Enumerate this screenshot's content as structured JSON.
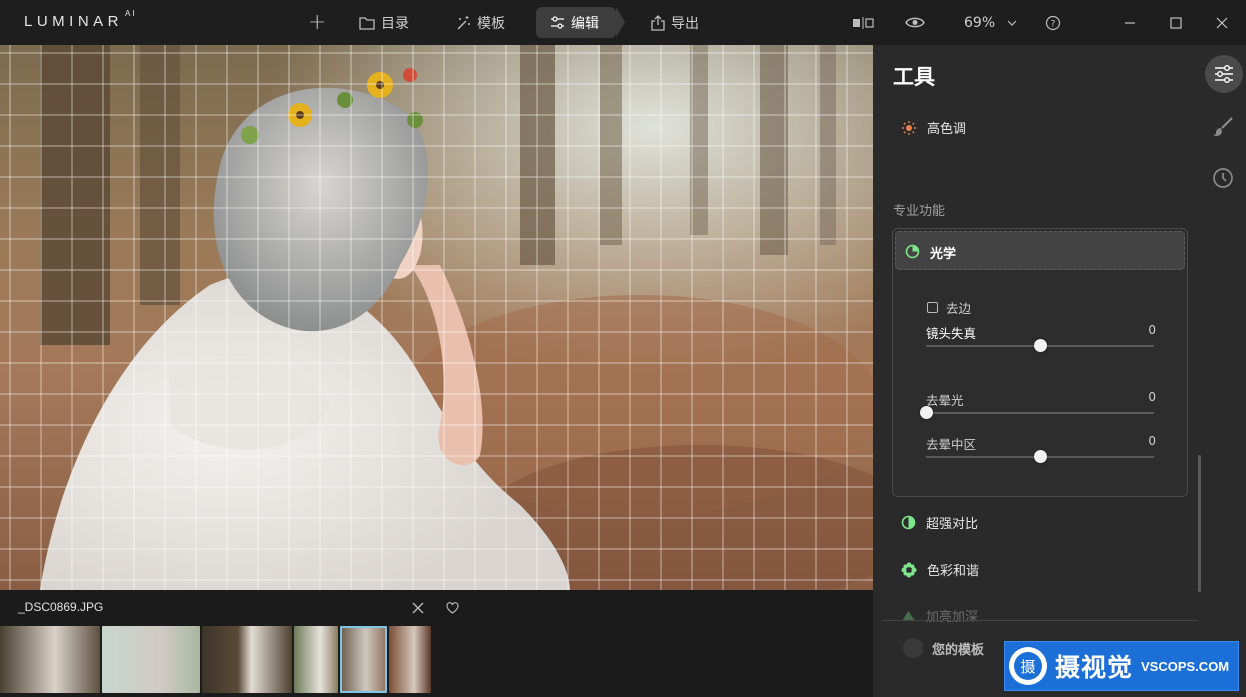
{
  "app": {
    "logo": "LUMINAR",
    "logo_sup": "AI"
  },
  "toolbar": {
    "add_label": "+",
    "catalog_label": "目录",
    "templates_label": "模板",
    "edit_label": "编辑",
    "export_label": "导出",
    "zoom": "69%"
  },
  "photo": {
    "filename": "_DSC0869.JPG",
    "grid": "on"
  },
  "filmstrip": {
    "thumb_count": 5,
    "selected_index": 5
  },
  "panel": {
    "title": "工具",
    "tool_high_key": "高色调",
    "section_pro": "专业功能",
    "optics_label": "光学",
    "defringe_label": "去边",
    "sliders": [
      {
        "label": "镜头失真",
        "value": "0",
        "level": 0.5
      },
      {
        "label": "去晕光",
        "value": "0",
        "level": 0.0
      },
      {
        "label": "去晕中区",
        "value": "0",
        "level": 0.5
      }
    ],
    "tool_supercontrast": "超强对比",
    "tool_color_harmony": "色彩和谐",
    "tool_dodge_burn": "加亮加深",
    "my_templates": "您的模板"
  },
  "watermark": {
    "text": "摄视觉",
    "domain": "VSCOPS.COM"
  },
  "colors": {
    "accent": "#7ee68a",
    "orange": "#e8834a",
    "selection": "#7fc6e6"
  }
}
